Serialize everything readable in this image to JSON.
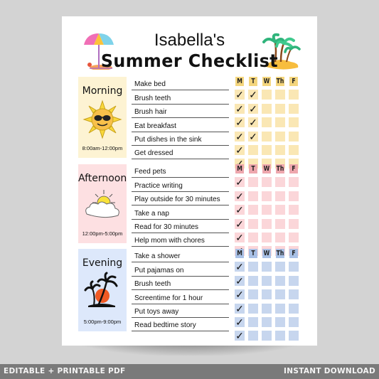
{
  "header": {
    "name_line": "Isabella's",
    "title_line": "Summer Checklist",
    "left_decoration": "beach-umbrella-icon",
    "right_decoration": "palm-island-icon"
  },
  "days": [
    "M",
    "T",
    "W",
    "Th",
    "F"
  ],
  "sections": [
    {
      "name": "Morning",
      "time": "8:00am-12:00pm",
      "icon": "sun-sunglasses-icon",
      "colors": {
        "panel": "#fdf3d3",
        "header": "#f4d57c",
        "cell": "#fae7b4"
      },
      "tasks": [
        {
          "label": "Make bed",
          "checks": [
            true,
            true,
            false,
            false,
            false
          ]
        },
        {
          "label": "Brush teeth",
          "checks": [
            true,
            true,
            false,
            false,
            false
          ]
        },
        {
          "label": "Brush hair",
          "checks": [
            true,
            true,
            false,
            false,
            false
          ]
        },
        {
          "label": "Eat breakfast",
          "checks": [
            true,
            true,
            false,
            false,
            false
          ]
        },
        {
          "label": "Put dishes in the sink",
          "checks": [
            true,
            false,
            false,
            false,
            false
          ]
        },
        {
          "label": "Get dressed",
          "checks": [
            true,
            false,
            false,
            false,
            false
          ]
        }
      ]
    },
    {
      "name": "Afternoon",
      "time": "12:00pm-5:00pm",
      "icon": "sun-cloud-icon",
      "colors": {
        "panel": "#fde0e2",
        "header": "#eea7ad",
        "cell": "#fbd6d9"
      },
      "tasks": [
        {
          "label": "Feed pets",
          "checks": [
            true,
            false,
            false,
            false,
            false
          ]
        },
        {
          "label": "Practice writing",
          "checks": [
            true,
            false,
            false,
            false,
            false
          ]
        },
        {
          "label": "Play outside for 30 minutes",
          "checks": [
            true,
            false,
            false,
            false,
            false
          ]
        },
        {
          "label": "Take a nap",
          "checks": [
            true,
            false,
            false,
            false,
            false
          ]
        },
        {
          "label": "Read for 30 minutes",
          "checks": [
            true,
            false,
            false,
            false,
            false
          ]
        },
        {
          "label": "Help mom with chores",
          "checks": [
            true,
            false,
            false,
            false,
            false
          ]
        }
      ]
    },
    {
      "name": "Evening",
      "time": "5:00pm-9:00pm",
      "icon": "palm-sunset-icon",
      "colors": {
        "panel": "#dde8fb",
        "header": "#a8c0e6",
        "cell": "#c7d6ee"
      },
      "tasks": [
        {
          "label": "Take a shower",
          "checks": [
            true,
            false,
            false,
            false,
            false
          ]
        },
        {
          "label": "Put pajamas on",
          "checks": [
            true,
            false,
            false,
            false,
            false
          ]
        },
        {
          "label": "Brush teeth",
          "checks": [
            true,
            false,
            false,
            false,
            false
          ]
        },
        {
          "label": "Screentime for 1 hour",
          "checks": [
            true,
            false,
            false,
            false,
            false
          ]
        },
        {
          "label": "Put toys away",
          "checks": [
            true,
            false,
            false,
            false,
            false
          ]
        },
        {
          "label": "Read bedtime story",
          "checks": [
            true,
            false,
            false,
            false,
            false
          ]
        }
      ]
    }
  ],
  "check_glyph": "✓",
  "footer": {
    "left": "EDITABLE + PRINTABLE PDF",
    "right": "INSTANT DOWNLOAD"
  }
}
